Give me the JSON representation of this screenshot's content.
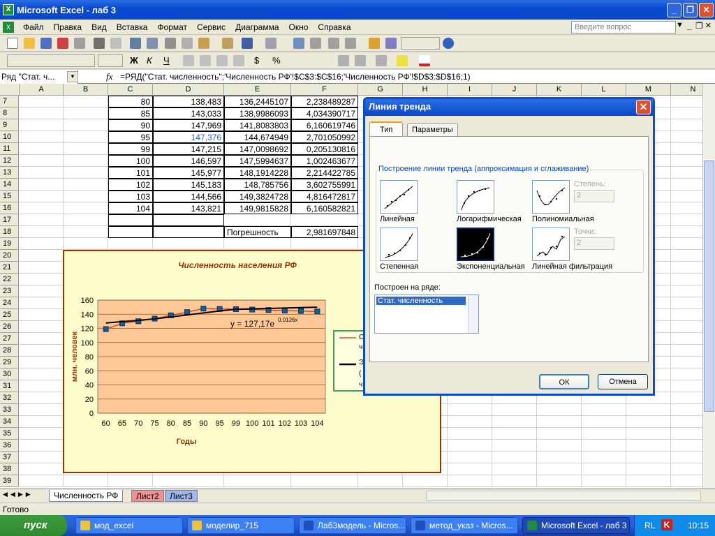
{
  "window": {
    "title": "Microsoft Excel - лаб 3",
    "minimize": "_",
    "restore": "❐",
    "close": "✕"
  },
  "menu": {
    "items": [
      "Файл",
      "Правка",
      "Вид",
      "Вставка",
      "Формат",
      "Сервис",
      "Диаграмма",
      "Окно",
      "Справка"
    ],
    "ask_placeholder": "Введите вопрос",
    "doc_min": "_",
    "doc_restore": "❐",
    "doc_close": "×"
  },
  "toolbar": {
    "font_buttons": [
      "Ж",
      "К",
      "Ч"
    ],
    "currency": "$",
    "percent": "%"
  },
  "formula_bar": {
    "name_box": "Ряд \"Стат. ч...",
    "fx": "fx",
    "formula": "=РЯД(\"Стат. численность\";'Численность РФ'!$C$3:$C$16;'Численность РФ'!$D$3:$D$16;1)"
  },
  "columns": [
    "A",
    "B",
    "C",
    "D",
    "E",
    "F",
    "G",
    "H",
    "I",
    "J",
    "K",
    "L",
    "M",
    "N"
  ],
  "rows": [
    "7",
    "8",
    "9",
    "10",
    "11",
    "12",
    "13",
    "14",
    "15",
    "16",
    "17",
    "18",
    "19",
    "20",
    "21",
    "22",
    "23",
    "24",
    "25",
    "26",
    "27",
    "28",
    "29",
    "30",
    "31",
    "32",
    "33",
    "34",
    "35",
    "36",
    "37",
    "38",
    "39"
  ],
  "table": [
    [
      "80",
      "138,483",
      "136,2445107",
      "2,238489287"
    ],
    [
      "85",
      "143,033",
      "138,9986093",
      "4,034390717"
    ],
    [
      "90",
      "147,969",
      "141,8083803",
      "6,160619746"
    ],
    [
      "95",
      "147,376",
      "144,674949",
      "2,701050992"
    ],
    [
      "99",
      "147,215",
      "147,0098692",
      "0,205130816"
    ],
    [
      "100",
      "146,597",
      "147,5994637",
      "1,002463677"
    ],
    [
      "101",
      "145,977",
      "148,1914228",
      "2,214422785"
    ],
    [
      "102",
      "145,183",
      "148,785756",
      "3,602755991"
    ],
    [
      "103",
      "144,566",
      "149,3824728",
      "4,816472817"
    ],
    [
      "104",
      "143,821",
      "149,9815828",
      "6,160582821"
    ]
  ],
  "error_row": {
    "label": "Погрешность",
    "value": "2,981697848"
  },
  "chart_data": {
    "type": "line",
    "title": "Численность населения РФ",
    "xlabel": "Годы",
    "ylabel": "млн. человек",
    "categories": [
      "60",
      "65",
      "70",
      "75",
      "80",
      "85",
      "90",
      "95",
      "99",
      "100",
      "101",
      "102",
      "103",
      "104"
    ],
    "ylim": [
      0,
      160
    ],
    "yticks": [
      "0",
      "20",
      "40",
      "60",
      "80",
      "100",
      "120",
      "140",
      "160"
    ],
    "series": [
      {
        "values": [
          119.0,
          127.2,
          130.1,
          133.8,
          138.5,
          143.0,
          148.0,
          147.4,
          147.2,
          146.6,
          146.0,
          145.2,
          144.6,
          143.8
        ],
        "color": "#cc3300"
      },
      {
        "values": [
          127.7,
          129.5,
          131.4,
          133.5,
          136.2,
          139.0,
          141.8,
          144.7,
          147.0,
          147.6,
          148.2,
          148.8,
          149.4,
          150.0
        ],
        "color": "#000000"
      }
    ],
    "equation": "y = 127,17e",
    "equation_exp": "0,0126x",
    "legend_partial": [
      "С",
      "ч",
      "Э",
      "(",
      "ч"
    ],
    "grid": true,
    "plot_bg": "#ffc896"
  },
  "dialog": {
    "title": "Линия тренда",
    "tabs": [
      "Тип",
      "Параметры"
    ],
    "group_title": "Построение линии тренда (аппроксимация и сглаживание)",
    "types": [
      "Линейная",
      "Логарифмическая",
      "Полиномиальная",
      "Степенная",
      "Экспоненциальная",
      "Линейная фильтрация"
    ],
    "degree_label": "Степень:",
    "degree_value": "2",
    "points_label": "Точки:",
    "points_value": "2",
    "series_label": "Построен на ряде:",
    "series_items": [
      "Стат. численность"
    ],
    "ok": "ОК",
    "cancel": "Отмена"
  },
  "sheets": [
    "Численность РФ",
    "Лист2",
    "Лист3"
  ],
  "status": "Готово",
  "taskbar": {
    "start": "пуск",
    "tasks": [
      "мод_excel",
      "моделир_715",
      "Лаб3модель - Micros...",
      "метод_указ - Micros...",
      "Microsoft Excel - лаб 3"
    ],
    "lang": "RL",
    "time": "10:15"
  }
}
